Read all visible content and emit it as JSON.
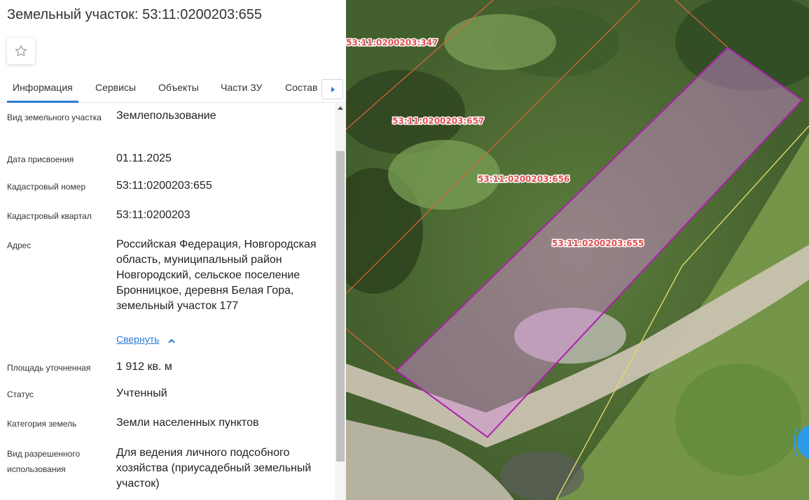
{
  "title": "Земельный участок: 53:11:0200203:655",
  "tabs": [
    {
      "label": "Информация",
      "active": true
    },
    {
      "label": "Сервисы"
    },
    {
      "label": "Объекты"
    },
    {
      "label": "Части ЗУ"
    },
    {
      "label": "Состав"
    }
  ],
  "fields": {
    "land_type": {
      "label": "Вид земельного участка",
      "value": "Землепользование"
    },
    "date": {
      "label": "Дата присвоения",
      "value": "01.11.2025"
    },
    "cadastral_number": {
      "label": "Кадастровый номер",
      "value": "53:11:0200203:655"
    },
    "cadastral_quarter": {
      "label": "Кадастровый квартал",
      "value": "53:11:0200203"
    },
    "address": {
      "label": "Адрес",
      "value": "Российская Федерация, Новгородская область, муниципальный район Новгородский, сельское поселение Бронницкое, деревня Белая Гора, земельный участок 177",
      "collapse": "Свернуть"
    },
    "area": {
      "label": "Площадь уточненная",
      "value": "1 912 кв. м"
    },
    "status": {
      "label": "Статус",
      "value": "Учтенный"
    },
    "category": {
      "label": "Категория земель",
      "value": "Земли населенных пунктов"
    },
    "permitted_use": {
      "label": "Вид разрешенного использования",
      "value": "Для ведения личного подсобного хозяйства (приусадебный земельный участок)"
    }
  },
  "map": {
    "parcels": [
      {
        "label": "53:11:0200203:347"
      },
      {
        "label": "53:11:0200203:657"
      },
      {
        "label": "53:11:0200203:656"
      },
      {
        "label": "53:11:0200203:655",
        "selected": true
      }
    ],
    "colors": {
      "selected_outline": "#b01fb0",
      "selected_fill": "#d98be0",
      "neighbor_outline": "#e0643c",
      "boundary_yellow": "#e2d96a"
    }
  },
  "icons": {
    "favorite": "star-outline-icon",
    "tabs_next": "chevron-right-icon",
    "collapse": "chevron-up-icon"
  }
}
